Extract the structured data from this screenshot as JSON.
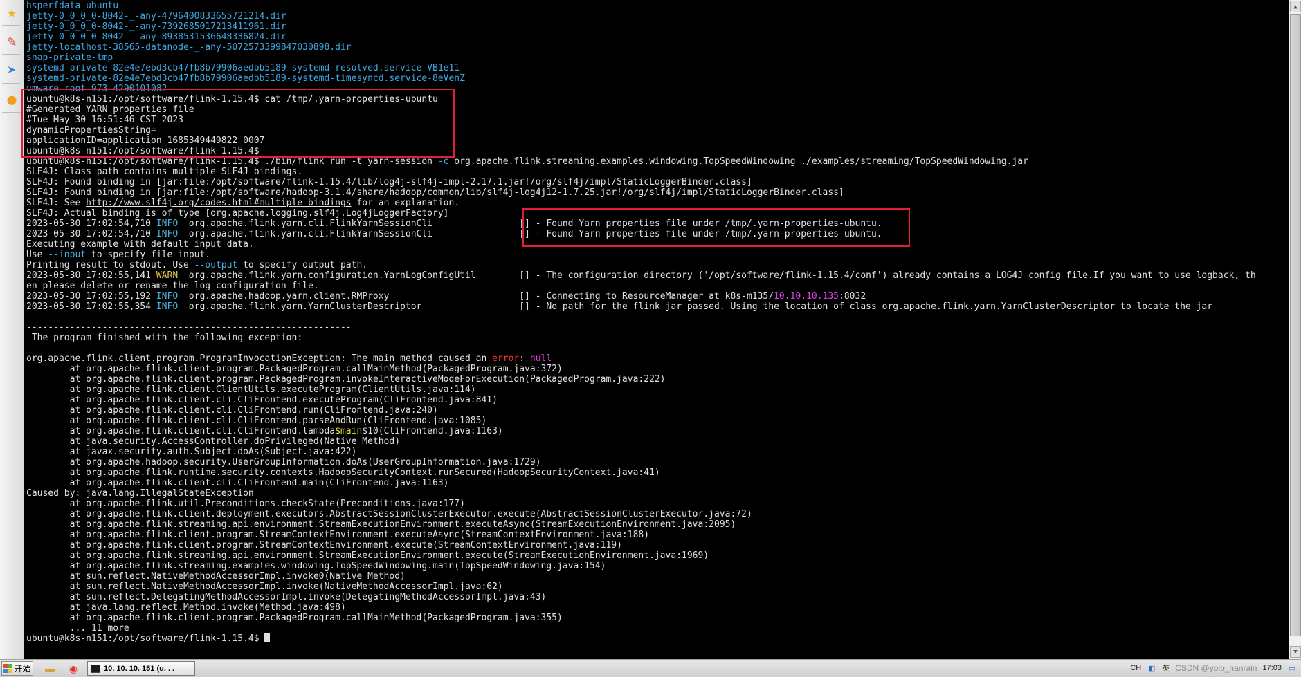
{
  "rail": {
    "icons": [
      "star-icon",
      "pen-icon",
      "send-icon",
      "disc-icon"
    ],
    "glyphs": [
      "★",
      "✎",
      "➤",
      "●"
    ]
  },
  "terminal": {
    "lines": [
      [
        {
          "t": "hsperfdata_ubuntu",
          "c": "blue"
        }
      ],
      [
        {
          "t": "jetty-0_0_0_0-8042-_-any-4796400833655721214.dir",
          "c": "blue"
        }
      ],
      [
        {
          "t": "jetty-0_0_0_0-8042-_-any-7392685017213411961.dir",
          "c": "blue"
        }
      ],
      [
        {
          "t": "jetty-0_0_0_0-8042-_-any-8938531536648336824.dir",
          "c": "blue"
        }
      ],
      [
        {
          "t": "jetty-localhost-38565-datanode-_-any-5072573399847030898.dir",
          "c": "blue"
        }
      ],
      [
        {
          "t": "snap-private-tmp",
          "c": "blue"
        }
      ],
      [
        {
          "t": "systemd-private-82e4e7ebd3cb47fb8b79906aedbb5189-systemd-resolved.service-VB1e11",
          "c": "blue"
        }
      ],
      [
        {
          "t": "systemd-private-82e4e7ebd3cb47fb8b79906aedbb5189-systemd-timesyncd.service-8eVenZ",
          "c": "blue"
        }
      ],
      [
        {
          "t": "vmware-root_973-4290101082",
          "c": "blue strike"
        }
      ],
      [
        {
          "t": "ubuntu@k8s-n151:/opt/software/flink-1.15.4$ cat /tmp/.yarn-properties-ubuntu"
        }
      ],
      [
        {
          "t": "#Generated YARN properties file"
        }
      ],
      [
        {
          "t": "#Tue May 30 16:51:46 CST 2023"
        }
      ],
      [
        {
          "t": "dynamicPropertiesString="
        }
      ],
      [
        {
          "t": "applicationID=application_1685349449822_0007"
        }
      ],
      [
        {
          "t": "ubuntu@k8s-n151:/opt/software/flink-1.15.4$"
        }
      ],
      [
        {
          "t": "ubuntu@k8s-n151:/opt/software/flink-1.15.4$ ./bin/flink run -t yarn-session "
        },
        {
          "t": "-c",
          "c": "cyan"
        },
        {
          "t": " org.apache.flink.streaming.examples.windowing.TopSpeedWindowing ./examples/streaming/TopSpeedWindowing.jar"
        }
      ],
      [
        {
          "t": "SLF4J: Class path contains multiple SLF4J bindings."
        }
      ],
      [
        {
          "t": "SLF4J: Found binding in [jar:file:/opt/software/flink-1.15.4/lib/log4j-slf4j-impl-2.17.1.jar!/org/slf4j/impl/StaticLoggerBinder.class]"
        }
      ],
      [
        {
          "t": "SLF4J: Found binding in [jar:file:/opt/software/hadoop-3.1.4/share/hadoop/common/lib/slf4j-log4j12-1.7.25.jar!/org/slf4j/impl/StaticLoggerBinder.class]"
        }
      ],
      [
        {
          "t": "SLF4J: See "
        },
        {
          "t": "http://www.slf4j.org/codes.html#multiple_bindings",
          "c": "link"
        },
        {
          "t": " for an explanation."
        }
      ],
      [
        {
          "t": "SLF4J: Actual binding is of type [org.apache.logging.slf4j.Log4jLoggerFactory]"
        }
      ],
      [
        {
          "t": "2023-05-30 17:02:54,710 "
        },
        {
          "t": "INFO ",
          "c": "cyan"
        },
        {
          "t": " org.apache.flink.yarn.cli.FlinkYarnSessionCli                [] - Found Yarn properties file under /tmp/.yarn-properties-ubuntu."
        }
      ],
      [
        {
          "t": "2023-05-30 17:02:54,710 "
        },
        {
          "t": "INFO ",
          "c": "cyan"
        },
        {
          "t": " org.apache.flink.yarn.cli.FlinkYarnSessionCli                [] - Found Yarn properties file under /tmp/.yarn-properties-ubuntu."
        }
      ],
      [
        {
          "t": "Executing example with default input data."
        }
      ],
      [
        {
          "t": "Use "
        },
        {
          "t": "--input",
          "c": "cyan"
        },
        {
          "t": " to specify file input."
        }
      ],
      [
        {
          "t": "Printing result to stdout. Use "
        },
        {
          "t": "--output",
          "c": "cyan"
        },
        {
          "t": " to specify output path."
        }
      ],
      [
        {
          "t": "2023-05-30 17:02:55,141 "
        },
        {
          "t": "WARN ",
          "c": "warn"
        },
        {
          "t": " org.apache.flink.yarn.configuration.YarnLogConfigUtil        [] - The configuration directory ('/opt/software/flink-1.15.4/conf') already contains a LOG4J config file.If you want to use logback, th"
        }
      ],
      [
        {
          "t": "en please delete or rename the log configuration file."
        }
      ],
      [
        {
          "t": "2023-05-30 17:02:55,192 "
        },
        {
          "t": "INFO ",
          "c": "cyan"
        },
        {
          "t": " org.apache.hadoop.yarn.client.RMProxy                        [] - Connecting to ResourceManager at k8s-m135/"
        },
        {
          "t": "10.10.10.135",
          "c": "mag"
        },
        {
          "t": ":8032"
        }
      ],
      [
        {
          "t": "2023-05-30 17:02:55,354 "
        },
        {
          "t": "INFO ",
          "c": "cyan"
        },
        {
          "t": " org.apache.flink.yarn.YarnClusterDescriptor                  [] - No path for the flink jar passed. Using the location of class org.apache.flink.yarn.YarnClusterDescriptor to locate the jar"
        }
      ],
      [
        {
          "t": ""
        }
      ],
      [
        {
          "t": "------------------------------------------------------------"
        }
      ],
      [
        {
          "t": " The program finished with the following exception:"
        }
      ],
      [
        {
          "t": ""
        }
      ],
      [
        {
          "t": "org.apache.flink.client.program.ProgramInvocationException: The main method caused an "
        },
        {
          "t": "error",
          "c": "err"
        },
        {
          "t": ": "
        },
        {
          "t": "null",
          "c": "mag"
        }
      ],
      [
        {
          "t": "        at org.apache.flink.client.program.PackagedProgram.callMainMethod(PackagedProgram.java:372)"
        }
      ],
      [
        {
          "t": "        at org.apache.flink.client.program.PackagedProgram.invokeInteractiveModeForExecution(PackagedProgram.java:222)"
        }
      ],
      [
        {
          "t": "        at org.apache.flink.client.ClientUtils.executeProgram(ClientUtils.java:114)"
        }
      ],
      [
        {
          "t": "        at org.apache.flink.client.cli.CliFrontend.executeProgram(CliFrontend.java:841)"
        }
      ],
      [
        {
          "t": "        at org.apache.flink.client.cli.CliFrontend.run(CliFrontend.java:240)"
        }
      ],
      [
        {
          "t": "        at org.apache.flink.client.cli.CliFrontend.parseAndRun(CliFrontend.java:1085)"
        }
      ],
      [
        {
          "t": "        at org.apache.flink.client.cli.CliFrontend.lambda"
        },
        {
          "t": "$main",
          "c": "ylw"
        },
        {
          "t": "$10(CliFrontend.java:1163)"
        }
      ],
      [
        {
          "t": "        at java.security.AccessController.doPrivileged(Native Method)"
        }
      ],
      [
        {
          "t": "        at javax.security.auth.Subject.doAs(Subject.java:422)"
        }
      ],
      [
        {
          "t": "        at org.apache.hadoop.security.UserGroupInformation.doAs(UserGroupInformation.java:1729)"
        }
      ],
      [
        {
          "t": "        at org.apache.flink.runtime.security.contexts.HadoopSecurityContext.runSecured(HadoopSecurityContext.java:41)"
        }
      ],
      [
        {
          "t": "        at org.apache.flink.client.cli.CliFrontend.main(CliFrontend.java:1163)"
        }
      ],
      [
        {
          "t": "Caused by: java.lang.IllegalStateException"
        }
      ],
      [
        {
          "t": "        at org.apache.flink.util.Preconditions.checkState(Preconditions.java:177)"
        }
      ],
      [
        {
          "t": "        at org.apache.flink.client.deployment.executors.AbstractSessionClusterExecutor.execute(AbstractSessionClusterExecutor.java:72)"
        }
      ],
      [
        {
          "t": "        at org.apache.flink.streaming.api.environment.StreamExecutionEnvironment.executeAsync(StreamExecutionEnvironment.java:2095)"
        }
      ],
      [
        {
          "t": "        at org.apache.flink.client.program.StreamContextEnvironment.executeAsync(StreamContextEnvironment.java:188)"
        }
      ],
      [
        {
          "t": "        at org.apache.flink.client.program.StreamContextEnvironment.execute(StreamContextEnvironment.java:119)"
        }
      ],
      [
        {
          "t": "        at org.apache.flink.streaming.api.environment.StreamExecutionEnvironment.execute(StreamExecutionEnvironment.java:1969)"
        }
      ],
      [
        {
          "t": "        at org.apache.flink.streaming.examples.windowing.TopSpeedWindowing.main(TopSpeedWindowing.java:154)"
        }
      ],
      [
        {
          "t": "        at sun.reflect.NativeMethodAccessorImpl.invoke0(Native Method)"
        }
      ],
      [
        {
          "t": "        at sun.reflect.NativeMethodAccessorImpl.invoke(NativeMethodAccessorImpl.java:62)"
        }
      ],
      [
        {
          "t": "        at sun.reflect.DelegatingMethodAccessorImpl.invoke(DelegatingMethodAccessorImpl.java:43)"
        }
      ],
      [
        {
          "t": "        at java.lang.reflect.Method.invoke(Method.java:498)"
        }
      ],
      [
        {
          "t": "        at org.apache.flink.client.program.PackagedProgram.callMainMethod(PackagedProgram.java:355)"
        }
      ],
      [
        {
          "t": "        ... 11 more"
        }
      ],
      [
        {
          "t": "ubuntu@k8s-n151:/opt/software/flink-1.15.4$ "
        }
      ]
    ],
    "highlight_color": "#e0203a"
  },
  "taskbar": {
    "start_label": "开始",
    "task_label": "10. 10. 10. 151  (u. . .",
    "tray_lang": "CH",
    "tray_ime": "英",
    "tray_time": "17:03",
    "watermark": "CSDN @yolo_hanrain"
  }
}
